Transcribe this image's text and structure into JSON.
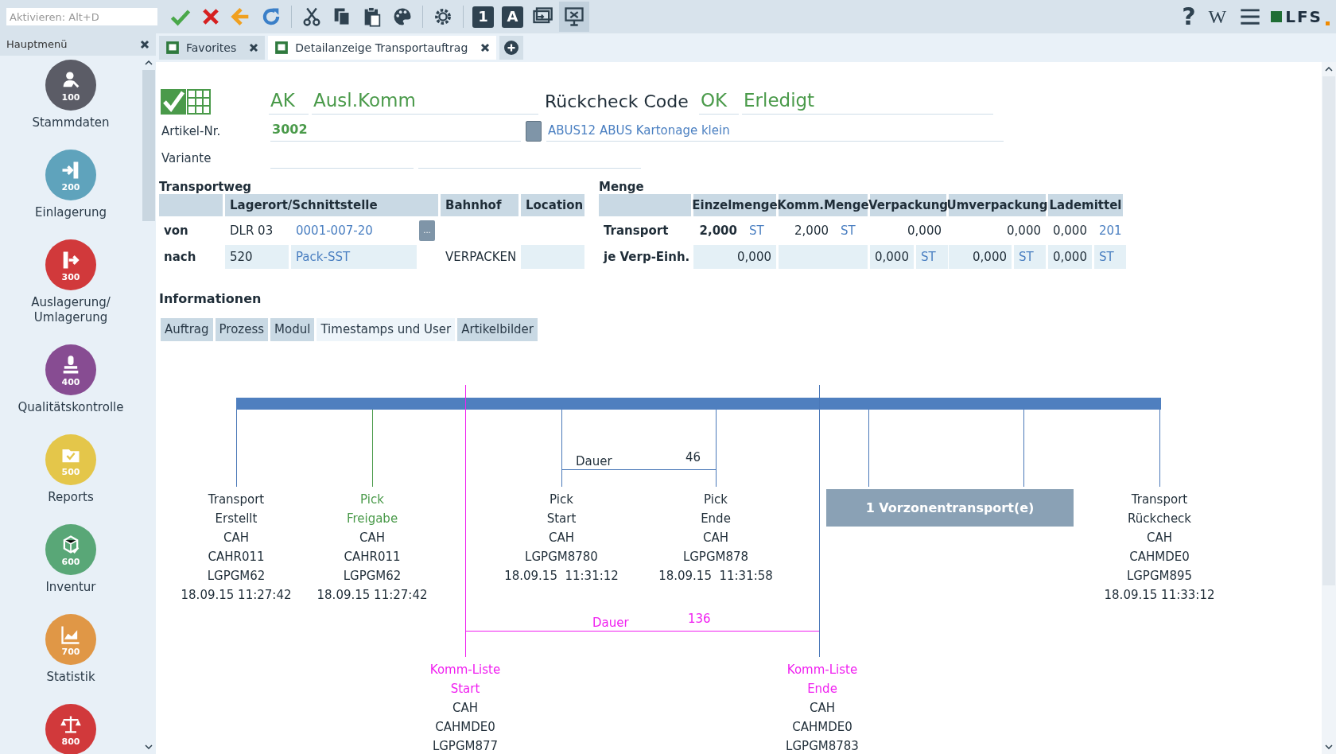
{
  "toolbar": {
    "activate_field": {
      "placeholder": "Aktivieren: Alt+D"
    },
    "number_button": "1",
    "letter_button": "A",
    "help": "?",
    "wiki": "W",
    "logo": "LFS"
  },
  "sidebar": {
    "title": "Hauptmenü",
    "items": [
      {
        "code": "100",
        "label": "Stammdaten",
        "color": "#5b5c66"
      },
      {
        "code": "200",
        "label": "Einlagerung",
        "color": "#5fa3bc"
      },
      {
        "code": "300",
        "label": "Auslagerung/ Umlagerung",
        "color": "#d1393b"
      },
      {
        "code": "400",
        "label": "Qualitätskontrolle",
        "color": "#874c92"
      },
      {
        "code": "500",
        "label": "Reports",
        "color": "#e4c64a"
      },
      {
        "code": "600",
        "label": "Inventur",
        "color": "#59a777"
      },
      {
        "code": "700",
        "label": "Statistik",
        "color": "#e09746"
      },
      {
        "code": "800",
        "color": "#d1393b"
      }
    ]
  },
  "tabs": [
    {
      "label": "Favorites",
      "selected": false
    },
    {
      "label": "Detailanzeige Transportauftrag",
      "selected": true
    }
  ],
  "header": {
    "type_code": "AK",
    "type_name": "Ausl.Komm",
    "check_label": "Rückcheck Code",
    "check_code": "OK",
    "check_status": "Erledigt",
    "article_label": "Artikel-Nr.",
    "article_number": "3002",
    "article_description": "ABUS12 ABUS Kartonage klein",
    "variant_label": "Variante"
  },
  "transportweg": {
    "title": "Transportweg",
    "columns": [
      "Lagerort/Schnittstelle",
      "Bahnhof",
      "Location"
    ],
    "rows": [
      {
        "label": "von",
        "place": "DLR 03",
        "interface": "0001-007-20",
        "bahnhof": null,
        "location": null
      },
      {
        "label": "nach",
        "place": "520",
        "interface": "Pack-SST",
        "bahnhof": "VERPACKEN",
        "location": null
      }
    ],
    "more_button": "..."
  },
  "menge": {
    "title": "Menge",
    "columns": [
      "Einzelmenge",
      "Komm.Menge",
      "Verpackung",
      "Umverpackung",
      "Lademittel"
    ],
    "rows": [
      {
        "label": "Transport",
        "cells": [
          {
            "value": "2,000",
            "unit": "ST",
            "bold": true
          },
          {
            "value": "2,000",
            "unit": "ST"
          },
          {
            "value": "0,000"
          },
          {
            "value": "0,000"
          },
          {
            "value": "0,000",
            "unit": "201"
          }
        ]
      },
      {
        "label": "je Verp-Einh.",
        "cells": [
          {
            "value": "0,000"
          },
          {},
          {
            "value": "0,000",
            "unit": "ST"
          },
          {
            "value": "0,000",
            "unit": "ST"
          },
          {
            "value": "0,000",
            "unit": "ST"
          }
        ]
      }
    ]
  },
  "informationen": {
    "title": "Informationen",
    "tabs": [
      {
        "label": "Auftrag",
        "selected": false
      },
      {
        "label": "Prozess",
        "selected": false
      },
      {
        "label": "Modul",
        "selected": false
      },
      {
        "label": "Timestamps und User",
        "selected": true
      },
      {
        "label": "Artikelbilder",
        "selected": false
      }
    ]
  },
  "timeline": {
    "events": [
      {
        "kind": "plain",
        "title": [
          "Transport",
          "Erstellt"
        ],
        "details": [
          "CAH",
          "CAHR011",
          "LGPGM62",
          "18.09.15 11:27:42"
        ]
      },
      {
        "kind": "release",
        "title": [
          "Pick",
          "Freigabe"
        ],
        "details": [
          "CAH",
          "CAHR011",
          "LGPGM62",
          "18.09.15 11:27:42"
        ]
      },
      {
        "kind": "plain",
        "title": [
          "Pick",
          "Start"
        ],
        "details": [
          "CAH",
          "LGPGM8780",
          "18.09.15  11:31:12"
        ]
      },
      {
        "kind": "plain",
        "title": [
          "Pick",
          "Ende"
        ],
        "details": [
          "CAH",
          "LGPGM878",
          "18.09.15  11:31:58"
        ]
      },
      {
        "kind": "plain",
        "title": [
          "Transport",
          "Rückcheck"
        ],
        "details": [
          "CAH",
          "CAHMDE0",
          "LGPGM895",
          "18.09.15 11:33:12"
        ]
      },
      {
        "kind": "list",
        "title": [
          "Komm-Liste",
          "Start"
        ],
        "details": [
          "CAH",
          "CAHMDE0",
          "LGPGM877"
        ]
      },
      {
        "kind": "list",
        "title": [
          "Komm-Liste",
          "Ende"
        ],
        "details": [
          "CAH",
          "CAHMDE0",
          "LGPGM8783"
        ]
      }
    ],
    "durations": [
      {
        "kind": "pick",
        "label": "Dauer",
        "value": "46"
      },
      {
        "kind": "list",
        "label": "Dauer",
        "value": "136"
      }
    ],
    "zone_button": "1 Vorzonentransport(e)"
  }
}
